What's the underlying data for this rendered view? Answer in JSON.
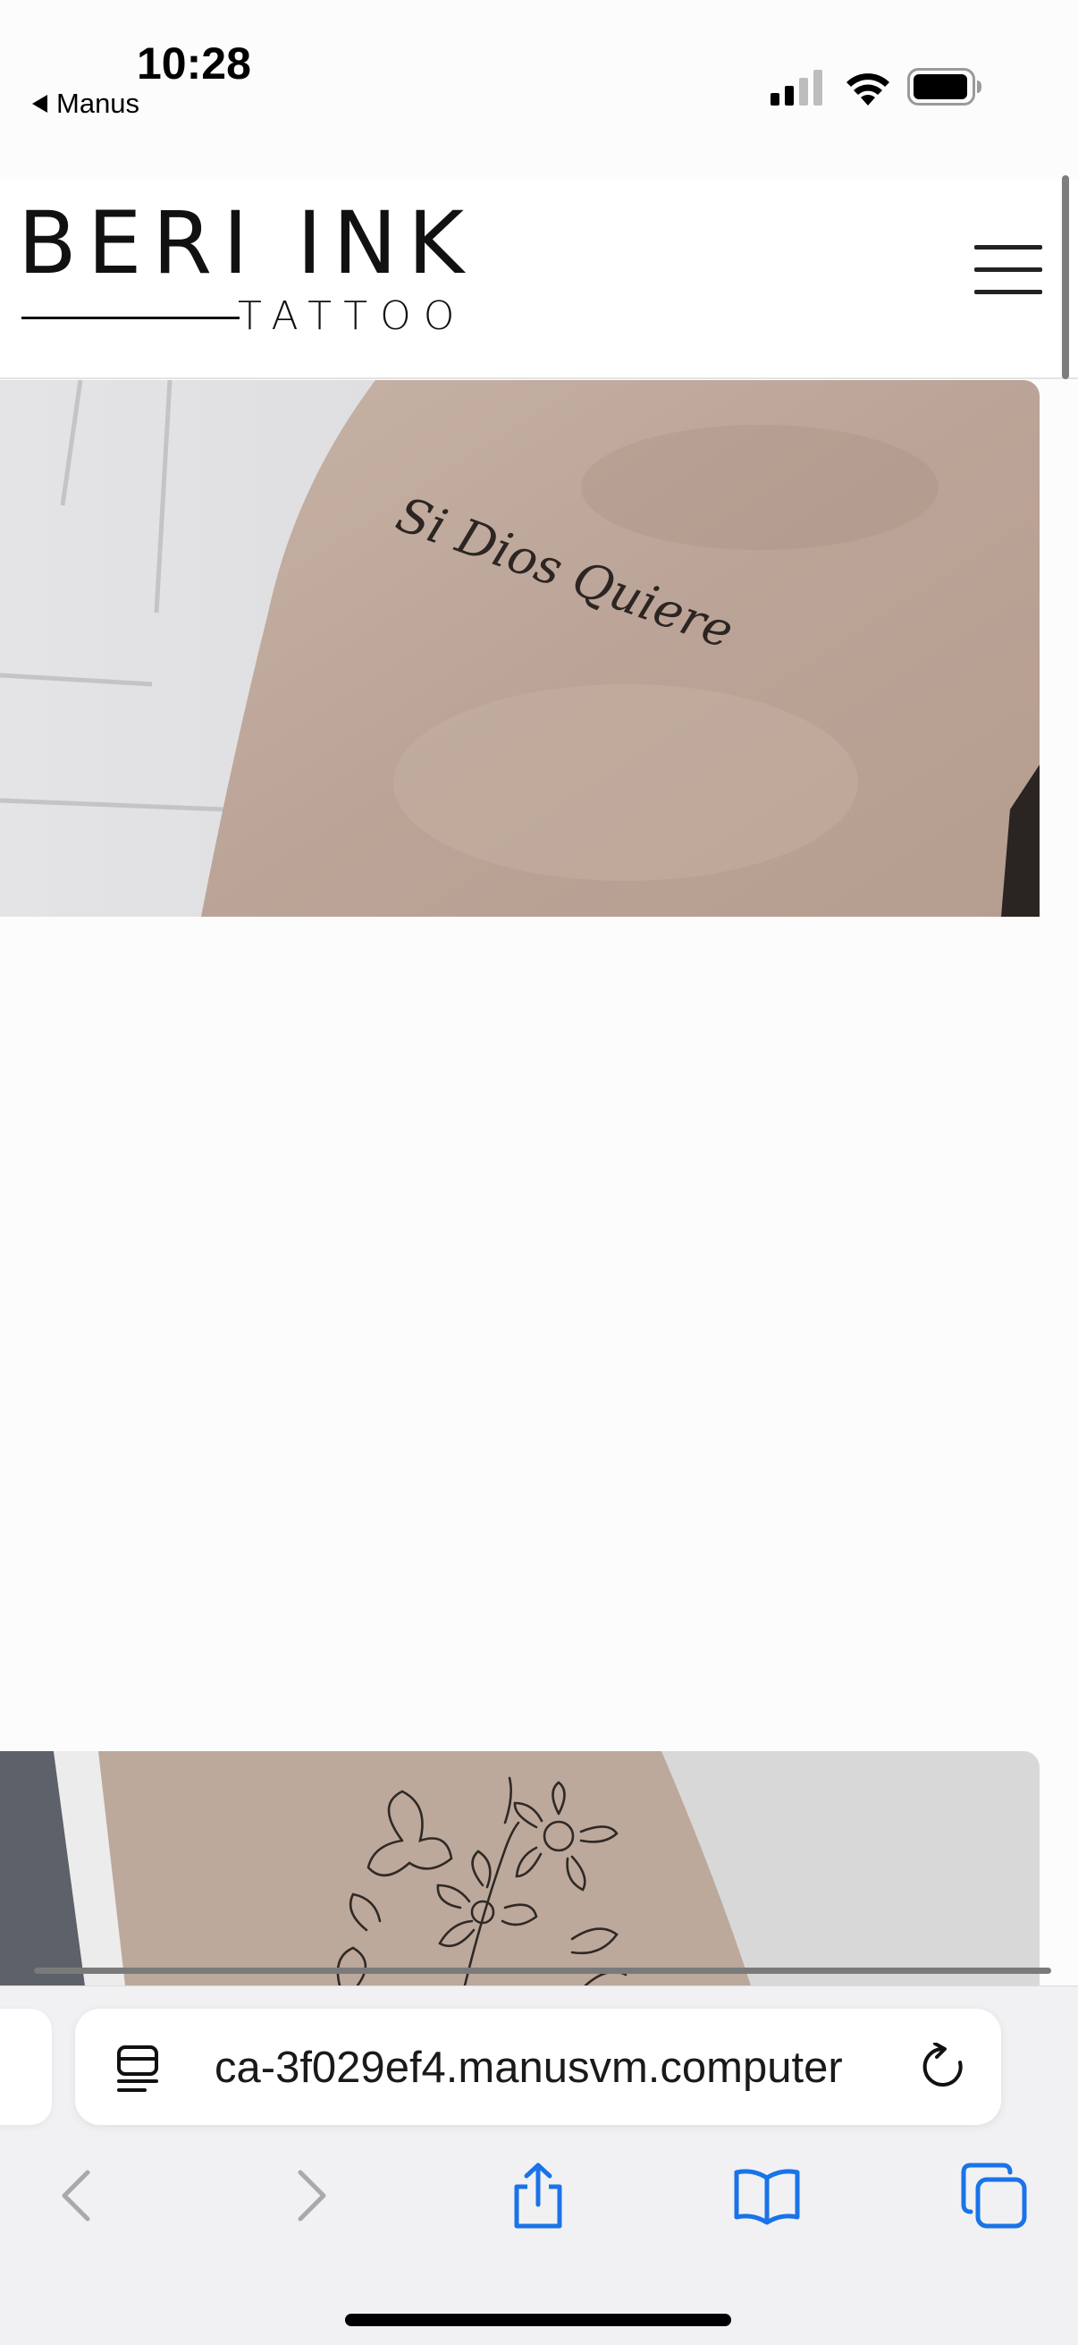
{
  "status_bar": {
    "time": "10:28",
    "back_app": "Manus",
    "icons": [
      "cellular-signal-icon",
      "wifi-icon",
      "battery-icon"
    ]
  },
  "site": {
    "logo_main": "BERI INK",
    "logo_sub": "TATTOO",
    "menu_icon": "hamburger-menu-icon"
  },
  "gallery": {
    "images": [
      {
        "alt": "Script lettering tattoo on forearm",
        "script": "Si Dios Quiere"
      },
      {
        "alt": "Fine line floral bouquet tattoo"
      }
    ]
  },
  "browser": {
    "url": "ca-3f029ef4.manusvm.computer",
    "icons": [
      "page-menu-icon",
      "reload-icon",
      "back-icon",
      "forward-icon",
      "share-icon",
      "bookmarks-icon",
      "tabs-icon"
    ]
  },
  "colors": {
    "accent": "#1a73e8",
    "disabled": "#a9a9ad",
    "page_bg": "#fdfcfc"
  }
}
